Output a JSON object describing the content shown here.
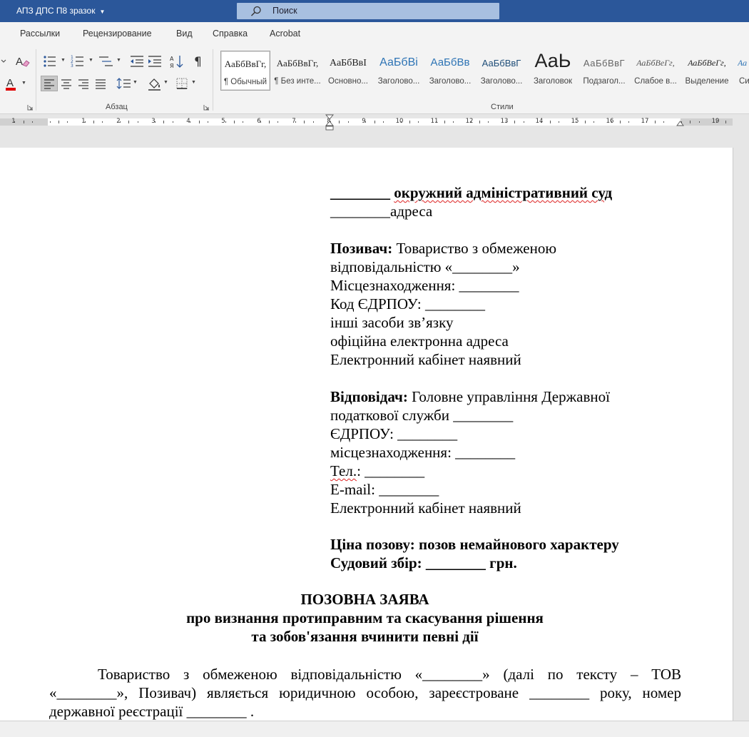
{
  "titlebar": {
    "doc_title": "АПЗ ДПС П8 зразок",
    "search_label": "Поиск",
    "accent": "#2b579a"
  },
  "ribbon": {
    "tabs": [
      "Рассылки",
      "Рецензирование",
      "Вид",
      "Справка",
      "Acrobat"
    ],
    "groups": {
      "paragraph": "Абзац",
      "styles": "Стили"
    },
    "styles": [
      {
        "preview": "АаБбВвГг,",
        "label": "¶ Обычный"
      },
      {
        "preview": "АаБбВвГг,",
        "label": "¶ Без инте..."
      },
      {
        "preview": "АаБбВвІ",
        "label": "Основно..."
      },
      {
        "preview": "АаБбВі",
        "label": "Заголово..."
      },
      {
        "preview": "АаБбВв",
        "label": "Заголово..."
      },
      {
        "preview": "АаБбВвГ",
        "label": "Заголово..."
      },
      {
        "preview": "АаЬ",
        "label": "Заголовок"
      },
      {
        "preview": "АаБбВвГ",
        "label": "Подзагол..."
      },
      {
        "preview": "АаБбВеГг,",
        "label": "Слабое в..."
      },
      {
        "preview": "АаБбВеГг,",
        "label": "Выделение"
      },
      {
        "preview": "Аа",
        "label": "Си"
      }
    ]
  },
  "ruler": {
    "numbers": [
      "1",
      "1",
      "2",
      "3",
      "4",
      "5",
      "6",
      "7",
      "8",
      "9",
      "10",
      "11",
      "12",
      "13",
      "14",
      "15",
      "16",
      "17",
      "19"
    ]
  },
  "document": {
    "court_blank": "________",
    "court_name": "окружний адміністративний суд",
    "address_line": "________адреса",
    "plaintiff_label": "Позивач:",
    "plaintiff_name_1": "Товариство з обмеженою",
    "plaintiff_name_2": "відповідальністю «________»",
    "plaintiff_location": "Місцезнаходження: ________",
    "plaintiff_edrpou": "Код ЄДРПОУ: ________",
    "plaintiff_contacts": "інші засоби зв’язку",
    "plaintiff_email": "офіційна електронна адреса",
    "plaintiff_cabinet": "Електронний кабінет наявний",
    "defendant_label": "Відповідач:",
    "defendant_name_1": "Головне управління Державної",
    "defendant_name_2": "податкової служби ________",
    "defendant_edrpou": "ЄДРПОУ: ________",
    "defendant_location": "місцезнаходження: ________",
    "defendant_tel_label": "Тел.",
    "defendant_tel_value": ": ________",
    "defendant_email": "E-mail: ________",
    "defendant_cabinet": "Електронний кабінет наявний",
    "claim_price": "Ціна позову: позов немайнового характеру",
    "court_fee": "Судовий збір: ________ грн.",
    "heading_1": "ПОЗОВНА ЗАЯВА",
    "heading_2": "про визнання протиправним та скасування рішення",
    "heading_3": "та зобов'язання вчинити певні дії",
    "para_line_1": "Товариство з обмеженою відповідальністю «________» (далі по тексту – ТОВ",
    "para_line_2": "«________», Позивач) являється юридичною особою, зареєстроване ________ року, номер",
    "para_line_3": "державної реєстрації ________ ."
  }
}
